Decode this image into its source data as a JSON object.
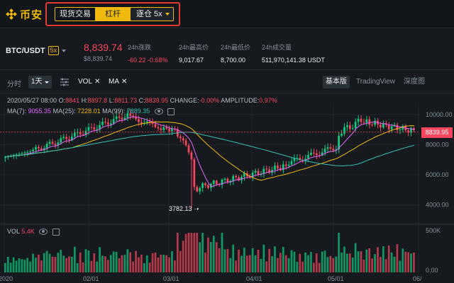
{
  "brand": {
    "name": "币安"
  },
  "mode": {
    "tabs": [
      "现货交易",
      "杠杆"
    ],
    "active": 1,
    "margin_select": "逐仓 5x"
  },
  "ticker": {
    "pair": "BTC/USDT",
    "leverage": "5x",
    "last_price": "8,839.74",
    "usd_price": "$8,839.74",
    "stats": [
      {
        "label": "24h涨跌",
        "value": "-60.22 -0.68%",
        "negative": true
      },
      {
        "label": "24h最高价",
        "value": "9,017.67",
        "negative": false
      },
      {
        "label": "24h最低价",
        "value": "8,700.00",
        "negative": false
      },
      {
        "label": "24h成交量",
        "value": "511,970,141.38 USDT",
        "negative": false
      }
    ]
  },
  "toolbar": {
    "time_label": "分时",
    "interval": "1天",
    "indicators": [
      "VOL",
      "MA"
    ],
    "views": [
      "基本版",
      "TradingView",
      "深度图"
    ],
    "active_view": 0
  },
  "chart_info": {
    "date": "2020/05/27 08:00",
    "open_label": "O:",
    "open": "8841",
    "high_label": "H:",
    "high": "8897.8",
    "low_label": "L:",
    "low": "8811.73",
    "close_label": "C:",
    "close": "8839.95",
    "change_label": "CHANGE:",
    "change": "-0.00%",
    "amplitude_label": "AMPLITUDE:",
    "amplitude": "0.97%",
    "ma": [
      {
        "label": "MA(7):",
        "value": "9055.35",
        "color": "#e563ff"
      },
      {
        "label": "MA(25):",
        "value": "7228.01",
        "color": "#f0b90b"
      },
      {
        "label": "MA(99):",
        "value": "7889.35",
        "color": "#30c0b4"
      }
    ]
  },
  "chart_data": {
    "type": "candlestick",
    "y_ticks": [
      "10000.00",
      "8000.00",
      "6000.00",
      "4000.00"
    ],
    "y_range": [
      3000,
      10800
    ],
    "current_price": "8839.95",
    "low_annotation": "3782.13",
    "x_ticks": [
      "2020",
      "02/01",
      "03/01",
      "04/01",
      "05/01",
      "06/"
    ],
    "volume_label": "VOL",
    "volume_value": "5.4K",
    "volume_ticks": [
      "500K",
      "0.00"
    ]
  }
}
